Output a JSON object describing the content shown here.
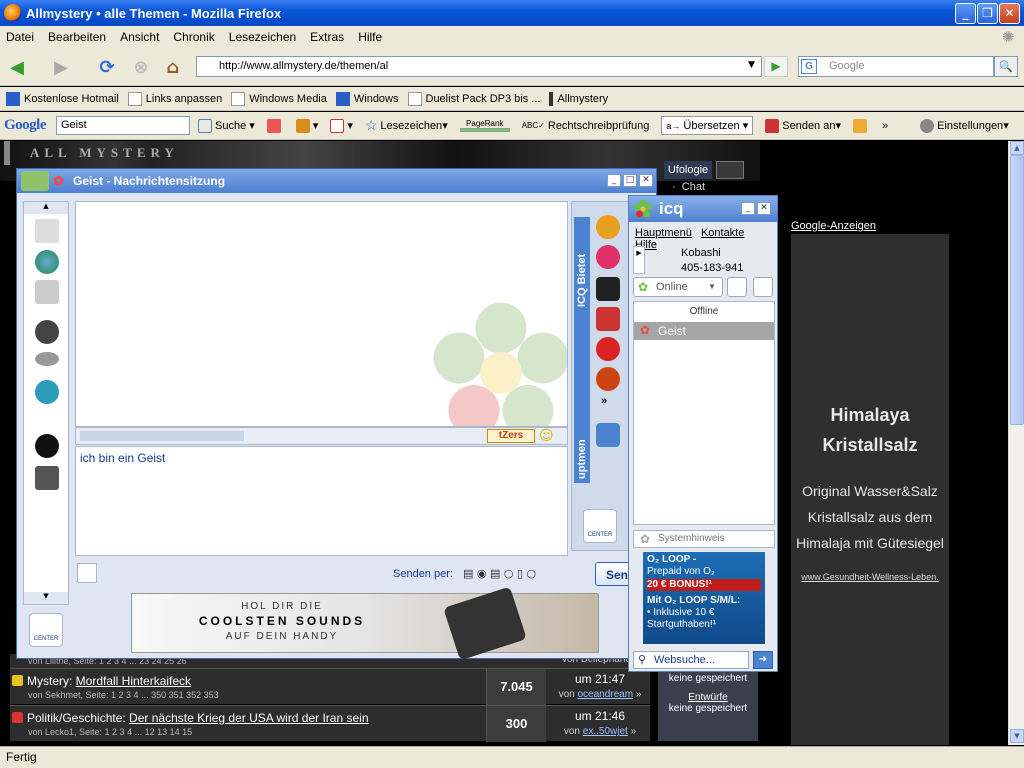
{
  "window": {
    "title": "Allmystery • alle Themen - Mozilla Firefox"
  },
  "menu": [
    "Datei",
    "Bearbeiten",
    "Ansicht",
    "Chronik",
    "Lesezeichen",
    "Extras",
    "Hilfe"
  ],
  "nav": {
    "url": "http://www.allmystery.de/themen/al",
    "search_placeholder": "Google"
  },
  "bookmarks": [
    "Kostenlose Hotmail",
    "Links anpassen",
    "Windows Media",
    "Windows",
    "Duelist Pack DP3 bis ...",
    "Allmystery"
  ],
  "googlebar": {
    "logo": "Google",
    "query": "Geist",
    "items": [
      "Suche",
      "Lesezeichen",
      "PageRank",
      "Rechtschreibprüfung",
      "Übersetzen",
      "Senden an",
      "»",
      "Einstellungen"
    ]
  },
  "site": {
    "tab_ufologie": "Ufologie",
    "chat": "Chat",
    "google_ads": "Google-Anzeigen",
    "ad": {
      "title": "Himalaya Kristallsalz",
      "text": "Original Wasser&Salz Kristallsalz aus dem Himalaja mit Gütesiegel",
      "url": "www.Gesundheit-Wellness-Leben."
    },
    "rows": [
      {
        "cat": "Mystery: ",
        "title": "Mordfall Hinterkaifeck",
        "meta": "von Sekhmet, Seite: 1 2 3 4 ... 350 351 352 353",
        "count": "7.045",
        "time": "um 21:47",
        "by_prefix": "von ",
        "by": "oceandream"
      },
      {
        "cat": "Politik/Geschichte: ",
        "title": "Der nächste Krieg der USA wird der Iran sein",
        "meta": "von Lecko1, Seite: 1 2 3 4 ... 12 13 14 15",
        "count": "300",
        "time": "um 21:46",
        "by_prefix": "von ",
        "by": "ex..50wjet"
      }
    ],
    "prev_meta": "von Lilithe, Seite: 1 2 3 4 ... 23 24 25 26",
    "prev_by": "von Bellephant",
    "side": {
      "saved1": "keine gespeichert",
      "drafts": "Entwürfe",
      "saved2": "keine gespeichert"
    }
  },
  "chat": {
    "title": "Geist - Nachrichtensitzung",
    "message": "ich bin ein Geist",
    "tzers": "tZers",
    "send_per": "Senden per:",
    "send": "Senden",
    "icq_bietet": "ICQ Bietet",
    "right_label": "uptmen",
    "center": "CENTER",
    "banner": {
      "line1": "HOL DIR DIE",
      "line2": "COOLSTEN SOUNDS",
      "line3": "AUF DEIN HANDY"
    }
  },
  "icq": {
    "title": "icq",
    "menu": [
      "Hauptmenü",
      "Kontakte",
      "Hilfe"
    ],
    "user_name": "Kobashi",
    "user_id": "405-183-941",
    "status": "Online",
    "offline": "Offline",
    "contact": "Geist",
    "system": "Systemhinweis",
    "o2": {
      "l1": "O₂ LOOP -",
      "l2": "Prepaid von O₂",
      "l3": "20 € BONUS!¹",
      "l4": "Mit O₂ LOOP S/M/L:",
      "l5": "• Inklusive 10 €",
      "l6": "Startguthaben!¹"
    },
    "websuche": "Websuche..."
  },
  "status": "Fertig"
}
